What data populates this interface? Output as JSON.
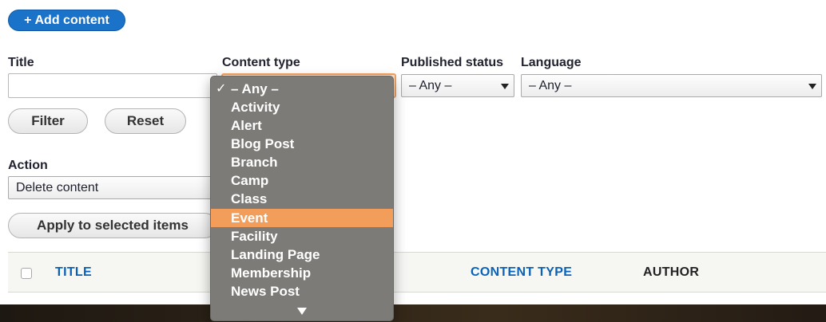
{
  "toolbar": {
    "add_content_label": "Add content",
    "add_icon": "plus-icon"
  },
  "filters": {
    "title_label": "Title",
    "title_value": "",
    "content_type_label": "Content type",
    "content_type_selected": "– Any –",
    "published_status_label": "Published status",
    "published_status_value": "– Any –",
    "language_label": "Language",
    "language_value": "– Any –",
    "filter_button": "Filter",
    "reset_button": "Reset"
  },
  "bulk": {
    "action_label": "Action",
    "action_value": "Delete content",
    "apply_button": "Apply to selected items"
  },
  "table": {
    "columns": [
      "TITLE",
      "CONTENT TYPE",
      "AUTHOR"
    ]
  },
  "dropdown": {
    "check_mark": "✓",
    "options": [
      "– Any –",
      "Activity",
      "Alert",
      "Blog Post",
      "Branch",
      "Camp",
      "Class",
      "Event",
      "Facility",
      "Landing Page",
      "Membership",
      "News Post"
    ],
    "checked": "– Any –",
    "highlighted": "Event"
  },
  "colors": {
    "accent": "#1a73c8",
    "highlight": "#f39d5a",
    "link": "#0a62b8"
  }
}
